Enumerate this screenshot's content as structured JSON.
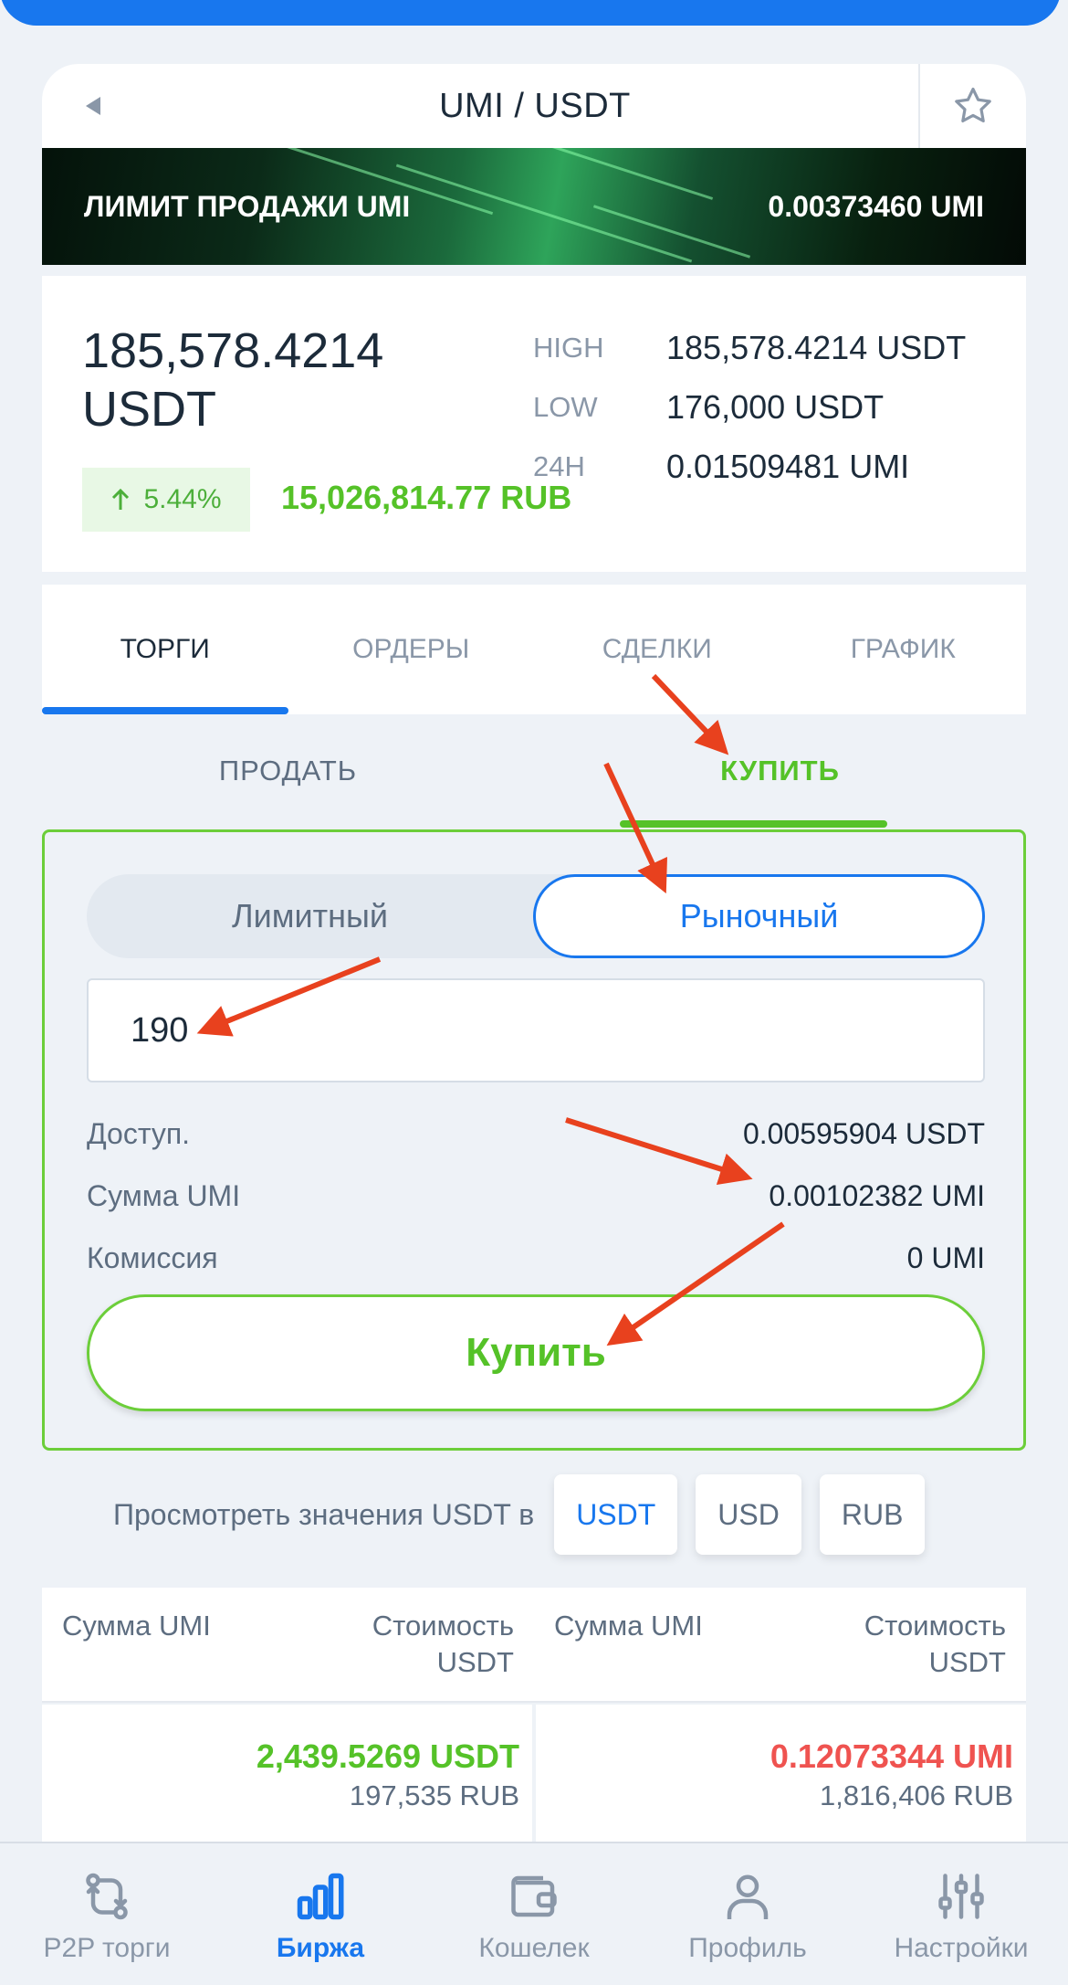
{
  "header": {
    "pair": "UMI / USDT"
  },
  "banner": {
    "label": "ЛИМИТ ПРОДАЖИ UMI",
    "value": "0.00373460 UMI"
  },
  "price": {
    "main": "185,578.4214 USDT",
    "change": "5.44%",
    "rub": "15,026,814.77 RUB",
    "stats": [
      {
        "label": "HIGH",
        "value": "185,578.4214 USDT"
      },
      {
        "label": "LOW",
        "value": "176,000 USDT"
      },
      {
        "label": "24H",
        "value": "0.01509481 UMI"
      }
    ]
  },
  "tabs": [
    "ТОРГИ",
    "ОРДЕРЫ",
    "СДЕЛКИ",
    "ГРАФИК"
  ],
  "sides": {
    "sell": "ПРОДАТЬ",
    "buy": "КУПИТЬ"
  },
  "order": {
    "type_limit": "Лимитный",
    "type_market": "Рыночный",
    "amount": "190",
    "available_label": "Доступ.",
    "available_value": "0.00595904 USDT",
    "sum_label": "Сумма UMI",
    "sum_value": "0.00102382 UMI",
    "fee_label": "Комиссия",
    "fee_value": "0 UMI",
    "buy_button": "Купить"
  },
  "currency": {
    "label": "Просмотреть значения USDT в",
    "options": [
      "USDT",
      "USD",
      "RUB"
    ],
    "selected": "USDT"
  },
  "orderbook": {
    "col1_left": "Сумма UMI",
    "col1_right": "Стоимость USDT",
    "col2_left": "Сумма UMI",
    "col2_right": "Стоимость USDT",
    "buy_main": "2,439.5269 USDT",
    "buy_sub": "197,535 RUB",
    "sell_main": "0.12073344 UMI",
    "sell_sub": "1,816,406 RUB"
  },
  "nav": [
    {
      "label": "P2P торги",
      "icon": "p2p-exchange-icon"
    },
    {
      "label": "Биржа",
      "icon": "bar-chart-icon"
    },
    {
      "label": "Кошелек",
      "icon": "wallet-icon"
    },
    {
      "label": "Профиль",
      "icon": "user-icon"
    },
    {
      "label": "Настройки",
      "icon": "sliders-icon"
    }
  ],
  "colors": {
    "accent": "#1877ee",
    "buy": "#55c228",
    "sell": "#ef5350",
    "annotation": "#e8411e"
  }
}
